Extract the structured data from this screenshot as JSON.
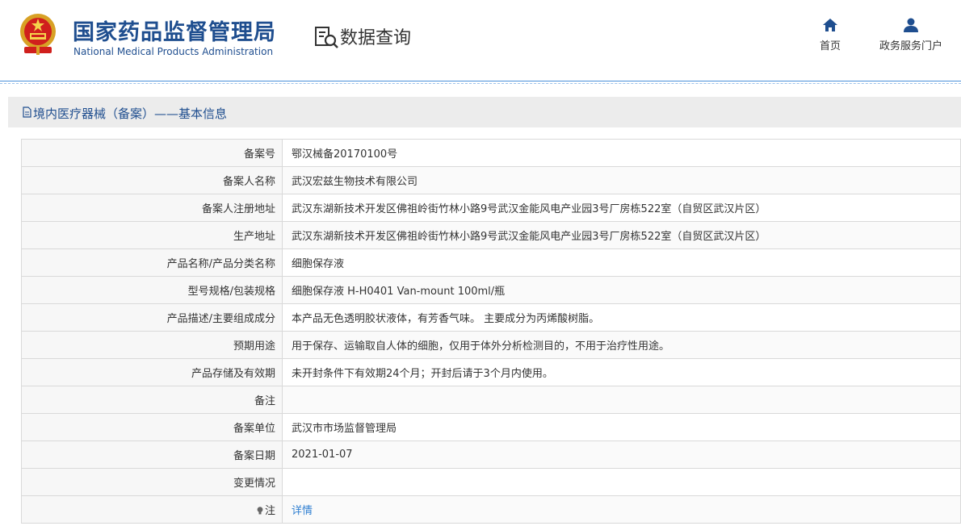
{
  "header": {
    "agency_cn": "国家药品监督管理局",
    "agency_en": "National Medical Products Administration",
    "query_title": "数据查询",
    "nav": [
      {
        "label": "首页",
        "icon": "home-icon"
      },
      {
        "label": "政务服务门户",
        "icon": "user-icon"
      }
    ]
  },
  "section": {
    "title": "境内医疗器械（备案）——基本信息",
    "icon": "document-icon"
  },
  "rows": [
    {
      "label": "备案号",
      "value": "鄂汉械备20170100号"
    },
    {
      "label": "备案人名称",
      "value": "武汉宏兹生物技术有限公司"
    },
    {
      "label": "备案人注册地址",
      "value": "武汉东湖新技术开发区佛祖岭街竹林小路9号武汉金能风电产业园3号厂房栋522室（自贸区武汉片区）"
    },
    {
      "label": "生产地址",
      "value": "武汉东湖新技术开发区佛祖岭街竹林小路9号武汉金能风电产业园3号厂房栋522室（自贸区武汉片区）"
    },
    {
      "label": "产品名称/产品分类名称",
      "value": "细胞保存液"
    },
    {
      "label": "型号规格/包装规格",
      "value": "细胞保存液 H-H0401 Van-mount 100ml/瓶"
    },
    {
      "label": "产品描述/主要组成成分",
      "value": "本产品无色透明胶状液体，有芳香气味。 主要成分为丙烯酸树脂。"
    },
    {
      "label": "预期用途",
      "value": "用于保存、运输取自人体的细胞，仅用于体外分析检测目的，不用于治疗性用途。"
    },
    {
      "label": "产品存储及有效期",
      "value": "未开封条件下有效期24个月；开封后请于3个月内使用。"
    },
    {
      "label": "备注",
      "value": ""
    },
    {
      "label": "备案单位",
      "value": "武汉市市场监督管理局"
    },
    {
      "label": "备案日期",
      "value": "2021-01-07"
    },
    {
      "label": "变更情况",
      "value": ""
    }
  ],
  "note": {
    "label": "注",
    "link": "详情",
    "icon": "bulb-icon"
  },
  "colors": {
    "brand_blue": "#1f4e8f",
    "link_blue": "#2f7fd1",
    "rule_blue": "#4a90d9"
  }
}
